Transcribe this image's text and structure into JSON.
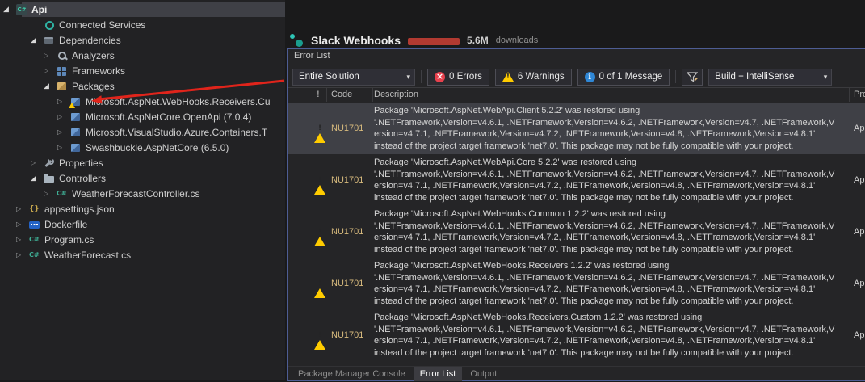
{
  "solution_explorer": {
    "items": [
      {
        "label": "Api",
        "level": 0,
        "expander": "expanded",
        "icon": "project",
        "selected": true,
        "bold": true
      },
      {
        "label": "Connected Services",
        "level": 2,
        "expander": "none",
        "icon": "connected"
      },
      {
        "label": "Dependencies",
        "level": 2,
        "expander": "expanded",
        "icon": "dependencies"
      },
      {
        "label": "Analyzers",
        "level": 3,
        "expander": "collapsed",
        "icon": "analyzers"
      },
      {
        "label": "Frameworks",
        "level": 3,
        "expander": "collapsed",
        "icon": "frameworks"
      },
      {
        "label": "Packages",
        "level": 3,
        "expander": "expanded",
        "icon": "packages"
      },
      {
        "label": "Microsoft.AspNet.WebHooks.Receivers.Cu",
        "level": 4,
        "expander": "collapsed",
        "icon": "package-warning"
      },
      {
        "label": "Microsoft.AspNetCore.OpenApi (7.0.4)",
        "level": 4,
        "expander": "collapsed",
        "icon": "package"
      },
      {
        "label": "Microsoft.VisualStudio.Azure.Containers.T",
        "level": 4,
        "expander": "collapsed",
        "icon": "package"
      },
      {
        "label": "Swashbuckle.AspNetCore (6.5.0)",
        "level": 4,
        "expander": "collapsed",
        "icon": "package"
      },
      {
        "label": "Properties",
        "level": 2,
        "expander": "collapsed",
        "icon": "properties"
      },
      {
        "label": "Controllers",
        "level": 2,
        "expander": "expanded",
        "icon": "folder"
      },
      {
        "label": "WeatherForecastController.cs",
        "level": 3,
        "expander": "collapsed",
        "icon": "csharp"
      },
      {
        "label": "appsettings.json",
        "level": 1,
        "expander": "collapsed",
        "icon": "json"
      },
      {
        "label": "Dockerfile",
        "level": 1,
        "expander": "collapsed",
        "icon": "docker"
      },
      {
        "label": "Program.cs",
        "level": 1,
        "expander": "collapsed",
        "icon": "csharp"
      },
      {
        "label": "WeatherForecast.cs",
        "level": 1,
        "expander": "collapsed",
        "icon": "csharp"
      }
    ]
  },
  "background": {
    "package_title": "Slack Webhooks",
    "downloads_count": "5.6M",
    "downloads_label": "downloads"
  },
  "error_list": {
    "title": "Error List",
    "toolbar": {
      "scope": "Entire Solution",
      "errors": "0 Errors",
      "warnings": "6 Warnings",
      "messages": "0 of 1 Message",
      "source": "Build + IntelliSense"
    },
    "columns": [
      "",
      "Code",
      "Description",
      "Project"
    ],
    "rows": [
      {
        "severity": "warning",
        "code": "NU1701",
        "project": "Api",
        "selected": true,
        "description": "Package 'Microsoft.AspNet.WebApi.Client 5.2.2' was restored using\n'.NETFramework,Version=v4.6.1, .NETFramework,Version=v4.6.2, .NETFramework,Version=v4.7, .NETFramework,V\nersion=v4.7.1, .NETFramework,Version=v4.7.2, .NETFramework,Version=v4.8, .NETFramework,Version=v4.8.1'\ninstead of the project target framework 'net7.0'. This package may not be fully compatible with your project."
      },
      {
        "severity": "warning",
        "code": "NU1701",
        "project": "Api",
        "selected": false,
        "description": "Package 'Microsoft.AspNet.WebApi.Core 5.2.2' was restored using\n'.NETFramework,Version=v4.6.1, .NETFramework,Version=v4.6.2, .NETFramework,Version=v4.7, .NETFramework,V\nersion=v4.7.1, .NETFramework,Version=v4.7.2, .NETFramework,Version=v4.8, .NETFramework,Version=v4.8.1'\ninstead of the project target framework 'net7.0'. This package may not be fully compatible with your project."
      },
      {
        "severity": "warning",
        "code": "NU1701",
        "project": "Api",
        "selected": false,
        "description": "Package 'Microsoft.AspNet.WebHooks.Common 1.2.2' was restored using\n'.NETFramework,Version=v4.6.1, .NETFramework,Version=v4.6.2, .NETFramework,Version=v4.7, .NETFramework,V\nersion=v4.7.1, .NETFramework,Version=v4.7.2, .NETFramework,Version=v4.8, .NETFramework,Version=v4.8.1'\ninstead of the project target framework 'net7.0'. This package may not be fully compatible with your project."
      },
      {
        "severity": "warning",
        "code": "NU1701",
        "project": "Api",
        "selected": false,
        "description": "Package 'Microsoft.AspNet.WebHooks.Receivers 1.2.2' was restored using\n'.NETFramework,Version=v4.6.1, .NETFramework,Version=v4.6.2, .NETFramework,Version=v4.7, .NETFramework,V\nersion=v4.7.1, .NETFramework,Version=v4.7.2, .NETFramework,Version=v4.8, .NETFramework,Version=v4.8.1'\ninstead of the project target framework 'net7.0'. This package may not be fully compatible with your project."
      },
      {
        "severity": "warning",
        "code": "NU1701",
        "project": "Api",
        "selected": false,
        "description": "Package 'Microsoft.AspNet.WebHooks.Receivers.Custom 1.2.2' was restored using\n'.NETFramework,Version=v4.6.1, .NETFramework,Version=v4.6.2, .NETFramework,Version=v4.7, .NETFramework,V\nersion=v4.7.1, .NETFramework,Version=v4.7.2, .NETFramework,Version=v4.8, .NETFramework,Version=v4.8.1'\ninstead of the project target framework 'net7.0'. This package may not be fully compatible with your project."
      }
    ],
    "tabs": [
      "Package Manager Console",
      "Error List",
      "Output"
    ],
    "active_tab": "Error List"
  },
  "colors": {
    "window_border": "#4e5d94",
    "warning_yellow": "#ffcc00",
    "error_red": "#e8414d",
    "info_blue": "#2f87d6",
    "selection_gray": "#3f4046",
    "annotation_arrow_red": "#e0241b"
  }
}
